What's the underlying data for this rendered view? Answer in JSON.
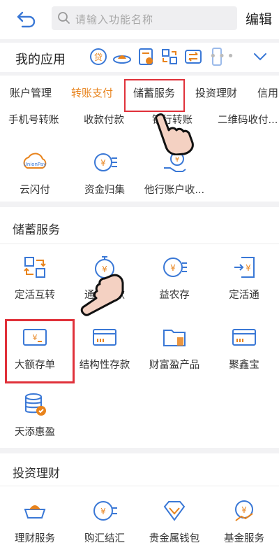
{
  "topbar": {
    "search_placeholder": "请输入功能名称",
    "edit_label": "编辑"
  },
  "my_apps": {
    "title": "我的应用",
    "mini_icons": [
      "loan-icon",
      "gold-ingot-icon",
      "calculator-icon",
      "exchange-icon",
      "transfer-icon",
      "phone-icon"
    ],
    "dots": "•••"
  },
  "categories": {
    "tabs": [
      {
        "label": "账户管理",
        "active": false
      },
      {
        "label": "转账支付",
        "active": true
      },
      {
        "label": "储蓄服务",
        "active": false
      },
      {
        "label": "投资理财",
        "active": false
      },
      {
        "label": "信用",
        "active": false
      }
    ],
    "row_labels": [
      "手机号转账",
      "收款付款",
      "银行转账",
      "二维码收付..."
    ],
    "items": [
      {
        "label": "云闪付",
        "icon": "cloud-pay-icon"
      },
      {
        "label": "资金归集",
        "icon": "fund-collect-icon"
      },
      {
        "label": "他行账户收...",
        "icon": "other-bank-icon"
      }
    ]
  },
  "savings": {
    "title": "储蓄服务",
    "items": [
      {
        "label": "定活互转",
        "icon": "swap-icon"
      },
      {
        "label": "通知存款",
        "icon": "stopwatch-yuan-icon"
      },
      {
        "label": "益农存",
        "icon": "coin-yuan-icon"
      },
      {
        "label": "定活通",
        "icon": "import-yuan-icon"
      },
      {
        "label": "大额存单",
        "icon": "certificate-icon"
      },
      {
        "label": "结构性存款",
        "icon": "card-icon"
      },
      {
        "label": "财富盈产品",
        "icon": "folder-icon"
      },
      {
        "label": "聚鑫宝",
        "icon": "card2-icon"
      },
      {
        "label": "天添惠盈",
        "icon": "db-coin-icon"
      }
    ]
  },
  "investment": {
    "title": "投资理财",
    "items": [
      {
        "label": "理财服务",
        "icon": "ingot-icon"
      },
      {
        "label": "购汇结汇",
        "icon": "currency-icon"
      },
      {
        "label": "贵金属钱包",
        "icon": "diamond-icon"
      },
      {
        "label": "基金服务",
        "icon": "fund-icon"
      }
    ]
  },
  "colors": {
    "accent": "#e8831c",
    "icon_blue": "#3a78d6",
    "highlight_red": "#e0313a"
  }
}
